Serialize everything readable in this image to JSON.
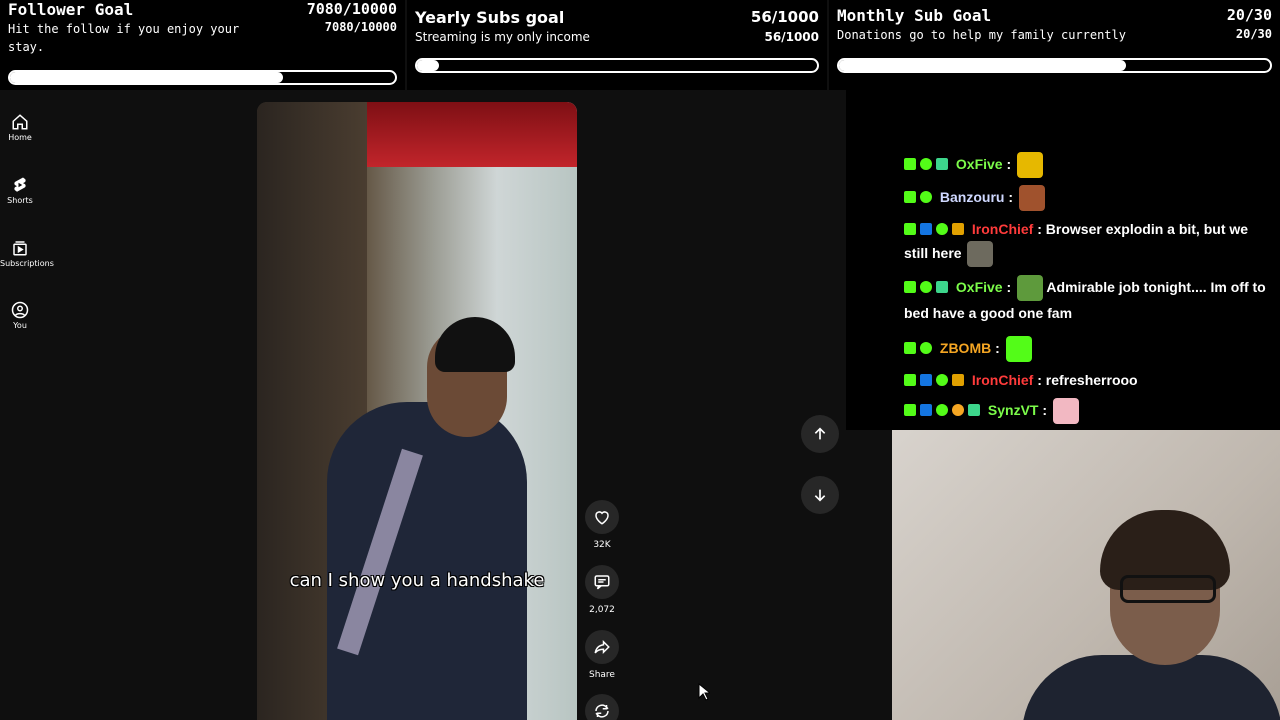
{
  "goals": {
    "follower": {
      "title": "Follower Goal",
      "count": "7080/10000",
      "desc": "Hit the follow if you enjoy your stay.",
      "progress": 0.708
    },
    "yearly": {
      "title": "Yearly Subs goal",
      "count": "56/1000",
      "desc": "Streaming is my only income",
      "progress": 0.056
    },
    "monthly": {
      "title": "Monthly Sub Goal",
      "count": "20/30",
      "desc": "Donations go to help my family currently",
      "progress": 0.667
    }
  },
  "sidebar": {
    "items": [
      {
        "label": "Home",
        "icon": "home-icon"
      },
      {
        "label": "Shorts",
        "icon": "shorts-icon"
      },
      {
        "label": "Subscriptions",
        "icon": "subscriptions-icon"
      },
      {
        "label": "You",
        "icon": "user-icon"
      }
    ]
  },
  "video": {
    "caption": "can I show you a handshake"
  },
  "actions": {
    "likes": "32K",
    "comments": "2,072",
    "share": "Share"
  },
  "chat": {
    "messages": [
      {
        "user": "OxFive",
        "text": "",
        "user_color": "#7cfc4a"
      },
      {
        "user": "Banzouru",
        "text": "",
        "user_color": "#cfd8ff"
      },
      {
        "user": "IronChief",
        "text": "Browser explodin a bit, but we still here",
        "user_color": "#ff3b3b"
      },
      {
        "user": "OxFive",
        "text": "Admirable job tonight.... Im off to bed have a good one fam",
        "user_color": "#7cfc4a"
      },
      {
        "user": "ZBOMB",
        "text": "",
        "user_color": "#f5a623"
      },
      {
        "user": "IronChief",
        "text": "refresherrooo",
        "user_color": "#ff3b3b"
      },
      {
        "user": "SynzVT",
        "text": "",
        "user_color": "#7cfc4a"
      }
    ]
  }
}
